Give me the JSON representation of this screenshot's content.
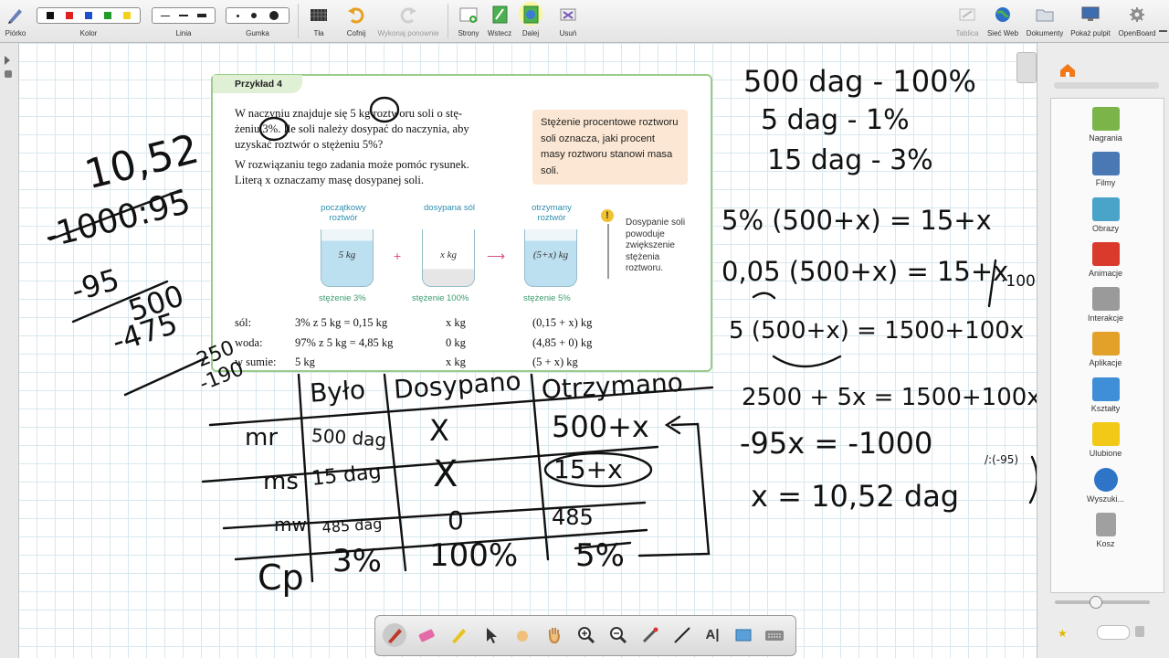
{
  "toolbar": {
    "pen_label": "Piórko",
    "color_label": "Kolor",
    "line_label": "Linia",
    "eraser_label": "Gumka",
    "background_label": "Tła",
    "undo_label": "Cofnij",
    "redo_label": "Wykonaj ponownie",
    "pages_label": "Strony",
    "back_label": "Wstecz",
    "forward_label": "Dalej",
    "delete_label": "Usuń",
    "board_label": "Tablica",
    "web_label": "Sieć Web",
    "documents_label": "Dokumenty",
    "desktop_label": "Pokaż pulpit",
    "openboard_label": "OpenBoard",
    "colors": [
      "#111111",
      "#e02020",
      "#1f4fd1",
      "#1f9c2a",
      "#f4d21a"
    ]
  },
  "example": {
    "title": "Przykład 4",
    "line1": "W naczyniu znajduje się 5 kg roztworu soli o stę-",
    "line2": "żeniu 3%. Ile soli należy dosypać do naczynia, aby",
    "line3": "uzyskać roztwór o stężeniu 5%?",
    "line4": "W rozwiązaniu tego zadania może pomóc rysunek.",
    "line5": "Literą x oznaczamy masę dosypanej soli.",
    "definition": "Stężenie procentowe roztworu soli oznacza, jaki procent masy roztworu stanowi masa soli.",
    "beakers": [
      {
        "label": "początkowy roztwór",
        "content": "5 kg",
        "concentration": "stężenie 3%"
      },
      {
        "label": "dosypana sól",
        "content": "x kg",
        "concentration": "stężenie 100%"
      },
      {
        "label": "otrzymany roztwór",
        "content": "(5+x) kg",
        "concentration": "stężenie 5%"
      }
    ],
    "plus": "+",
    "arrow": "⟶",
    "hint_icon": "!",
    "hint": "Dosypanie soli powoduje zwiększenie stężenia roztworu.",
    "rows": [
      {
        "name": "sól:",
        "a": "3% z 5 kg = 0,15 kg",
        "b": "x kg",
        "c": "(0,15 + x) kg"
      },
      {
        "name": "woda:",
        "a": "97% z 5 kg = 4,85 kg",
        "b": "0 kg",
        "c": "(4,85 + 0) kg"
      },
      {
        "name": "w sumie:",
        "a": "5 kg",
        "b": "x kg",
        "c": "(5 + x) kg"
      }
    ]
  },
  "handwriting": {
    "left_result": "10,52",
    "division": "-1000:95",
    "sub1": "-95",
    "n500": "500",
    "sub2": "-475",
    "n250": "250",
    "n190": "-190",
    "table_headers": [
      "Było",
      "Dosypano",
      "Otrzymano"
    ],
    "row_labels": [
      "mr",
      "ms",
      "mw",
      "Cp"
    ],
    "row_mr": [
      "500 dag",
      "X",
      "500+x"
    ],
    "row_ms": [
      "15 dag",
      "X",
      "15+x"
    ],
    "row_mw": [
      "485 dag",
      "0",
      "485"
    ],
    "row_cp": [
      "3%",
      "100%",
      "5%"
    ],
    "prop1": "500 dag - 100%",
    "prop2": "5 dag - 1%",
    "prop3": "15 dag - 3%",
    "eq1": "5% (500+x) = 15+x",
    "eq2": "0,05 (500+x) = 15+x",
    "eq2_mult": "·100",
    "eq3": "5 (500+x) = 1500+100x",
    "eq4": "2500 + 5x = 1500+100x",
    "eq5": "-95x = -1000",
    "eq5_div": "/:(-95)",
    "eq6": "x = 10,52 dag"
  },
  "library": {
    "items": [
      {
        "label": "Nagrania",
        "color": "#7bb54a"
      },
      {
        "label": "Filmy",
        "color": "#4a78b5"
      },
      {
        "label": "Obrazy",
        "color": "#4aa3c9"
      },
      {
        "label": "Animacje",
        "color": "#d93a2b"
      },
      {
        "label": "Interakcje",
        "color": "#9a9a9a"
      },
      {
        "label": "Aplikacje",
        "color": "#e3a12a"
      },
      {
        "label": "Kształty",
        "color": "#3f8fd8"
      },
      {
        "label": "Ulubione",
        "color": "#f2c916"
      },
      {
        "label": "Wyszuki...",
        "color": "#2e75c7"
      },
      {
        "label": "Kosz",
        "color": "#a0a0a0"
      }
    ]
  },
  "palette": {
    "text_tool": "A|"
  }
}
